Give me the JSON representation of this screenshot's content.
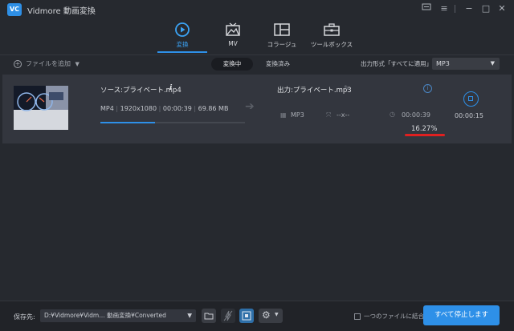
{
  "window": {
    "title": "Vidmore 動画変換",
    "app_icon_text": "VC",
    "controls": [
      "feedback-icon",
      "menu-icon",
      "minimize-icon",
      "maximize-icon",
      "close-icon"
    ]
  },
  "nav": {
    "tabs": [
      {
        "label": "変換",
        "icon": "convert-icon",
        "active": true
      },
      {
        "label": "MV",
        "icon": "mv-icon",
        "active": false
      },
      {
        "label": "コラージュ",
        "icon": "collage-icon",
        "active": false
      },
      {
        "label": "ツールボックス",
        "icon": "toolbox-icon",
        "active": false
      }
    ]
  },
  "toolbar": {
    "add_file": "ファイルを追加",
    "status_tabs": {
      "active": "変換中",
      "done": "変換済み"
    },
    "output_format_label": "出力形式「すべてに適用」:",
    "output_format_value": "MP3"
  },
  "file": {
    "source_name": "ソース:プライベート.mp4",
    "format": "MP4",
    "resolution": "1920x1080",
    "duration": "00:00:39",
    "size": "69.86 MB",
    "output_name": "出力:プライベート.mp3",
    "output_format": "MP3",
    "output_resolution": "--x--",
    "output_duration": "00:00:39",
    "remaining": "00:00:15",
    "percent": "16.27%",
    "progress_fraction": 0.38
  },
  "bottom": {
    "save_label": "保存先:",
    "save_path": "D:¥Vidmore¥Vidm… 動画変換¥Converted",
    "merge_label": "一つのファイルに結合",
    "stop_all": "すべて停止します"
  },
  "colors": {
    "accent": "#2e90e8",
    "background": "#26292f",
    "row": "#33363e",
    "annotation_red": "#e02020"
  }
}
